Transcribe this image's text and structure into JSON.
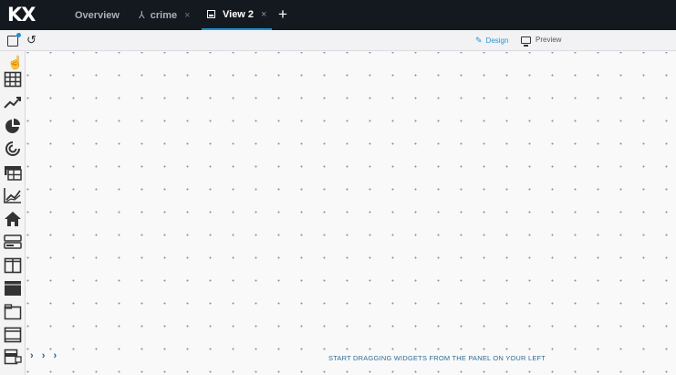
{
  "app": {
    "logo": "KX"
  },
  "tabs": [
    {
      "label": "Overview",
      "icon": "",
      "closable": false,
      "active": false
    },
    {
      "label": "crime",
      "icon": "branch-icon",
      "close": "×",
      "active": false
    },
    {
      "label": "View 2",
      "icon": "sheet-icon",
      "close": "×",
      "active": true
    }
  ],
  "add_tab": "+",
  "toolbar": {
    "save_icon": "save-icon",
    "undo_icon": "undo-icon",
    "design_label": "Design",
    "preview_label": "Preview"
  },
  "widgets_panel": {
    "widgets": [
      "table-icon",
      "line-chart-icon",
      "pie-chart-icon",
      "radial-icon",
      "pivot-table-icon",
      "area-chart-icon",
      "home-icon",
      "form-icon",
      "columns-layout-icon",
      "header-block-icon",
      "tabs-icon",
      "layout-frame-icon",
      "form-stack-icon"
    ]
  },
  "canvas": {
    "chevrons": "› › ›",
    "hint": "START DRAGGING WIDGETS FROM THE PANEL ON YOUR LEFT"
  },
  "colors": {
    "topbar": "#14181f",
    "accent": "#1f8fd2",
    "hint": "#2f6d93"
  }
}
